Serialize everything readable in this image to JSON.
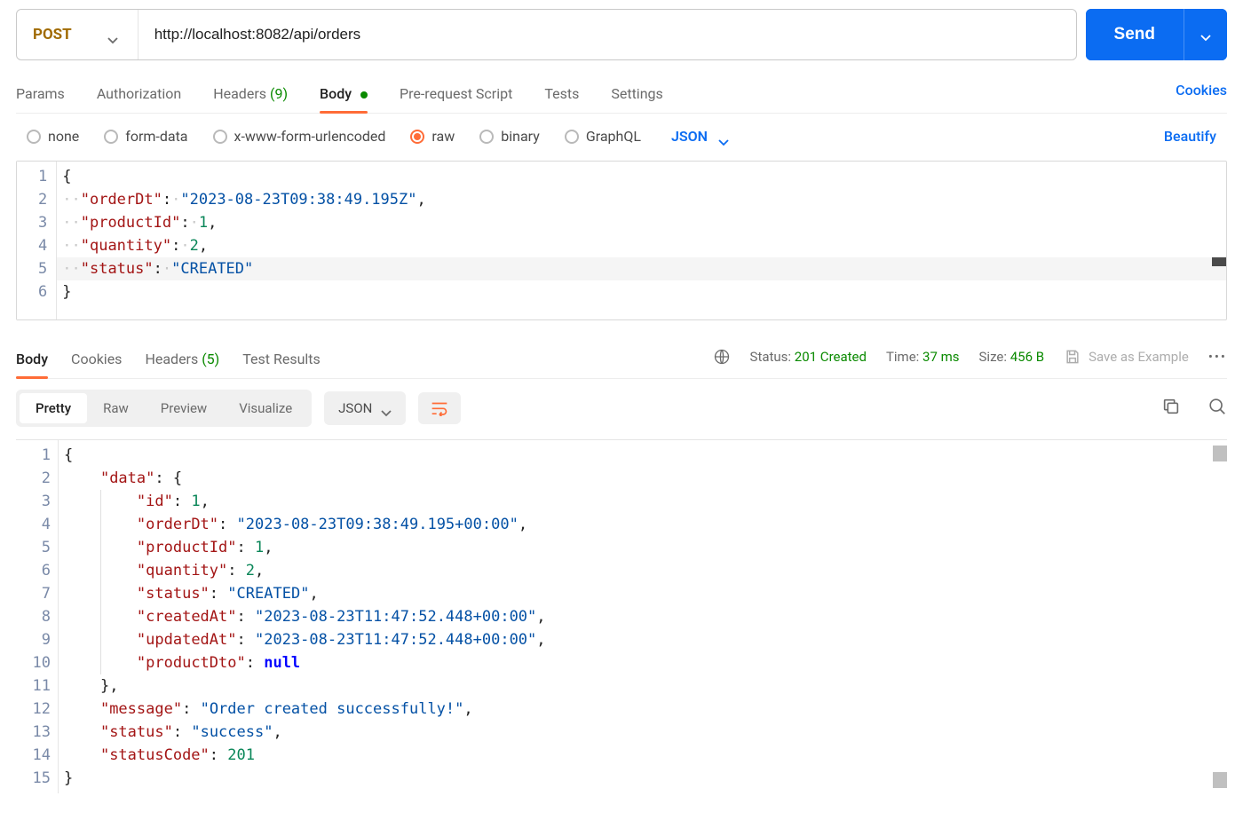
{
  "request": {
    "method": "POST",
    "url": "http://localhost:8082/api/orders",
    "send_label": "Send"
  },
  "tabs": {
    "params": "Params",
    "authorization": "Authorization",
    "headers_label": "Headers",
    "headers_count": "(9)",
    "body": "Body",
    "prerequest": "Pre-request Script",
    "tests": "Tests",
    "settings": "Settings",
    "cookies": "Cookies"
  },
  "body_types": {
    "none": "none",
    "form_data": "form-data",
    "urlencoded": "x-www-form-urlencoded",
    "raw": "raw",
    "binary": "binary",
    "graphql": "GraphQL",
    "format": "JSON",
    "beautify": "Beautify"
  },
  "request_body_lines": [
    "1",
    "2",
    "3",
    "4",
    "5",
    "6"
  ],
  "request_body": {
    "orderDt": "2023-08-23T09:38:49.195Z",
    "productId": 1,
    "quantity": 2,
    "status": "CREATED"
  },
  "response_tabs": {
    "body": "Body",
    "cookies": "Cookies",
    "headers_label": "Headers",
    "headers_count": "(5)",
    "test_results": "Test Results"
  },
  "response_meta": {
    "status_label": "Status:",
    "status_value": "201 Created",
    "time_label": "Time:",
    "time_value": "37 ms",
    "size_label": "Size:",
    "size_value": "456 B",
    "save_example": "Save as Example"
  },
  "view_tabs": {
    "pretty": "Pretty",
    "raw": "Raw",
    "preview": "Preview",
    "visualize": "Visualize",
    "format": "JSON"
  },
  "response_body_lines": [
    "1",
    "2",
    "3",
    "4",
    "5",
    "6",
    "7",
    "8",
    "9",
    "10",
    "11",
    "12",
    "13",
    "14",
    "15"
  ],
  "response_body": {
    "data": {
      "id": 1,
      "orderDt": "2023-08-23T09:38:49.195+00:00",
      "productId": 1,
      "quantity": 2,
      "status": "CREATED",
      "createdAt": "2023-08-23T11:47:52.448+00:00",
      "updatedAt": "2023-08-23T11:47:52.448+00:00",
      "productDto": null
    },
    "message": "Order created successfully!",
    "status": "success",
    "statusCode": 201
  }
}
